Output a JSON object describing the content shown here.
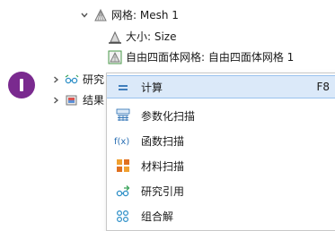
{
  "tree": {
    "mesh": {
      "label": "网格: Mesh 1"
    },
    "size": {
      "label": "大小: Size"
    },
    "tet": {
      "label": "自由四面体网格: 自由四面体网格 1"
    },
    "study": {
      "label": "研究"
    },
    "results": {
      "label": "结果"
    }
  },
  "menu": {
    "items": [
      {
        "label": "计算",
        "shortcut": "F8",
        "icon": "equals-icon"
      },
      {
        "label": "参数化扫描",
        "icon": "parametric-sweep-icon"
      },
      {
        "label": "函数扫描",
        "icon": "function-sweep-icon"
      },
      {
        "label": "材料扫描",
        "icon": "material-sweep-icon"
      },
      {
        "label": "研究引用",
        "icon": "study-reference-icon"
      },
      {
        "label": "组合解",
        "icon": "combine-solutions-icon"
      }
    ]
  },
  "colors": {
    "highlight": "#dbe9f9",
    "avatar": "#7a2a8f"
  }
}
